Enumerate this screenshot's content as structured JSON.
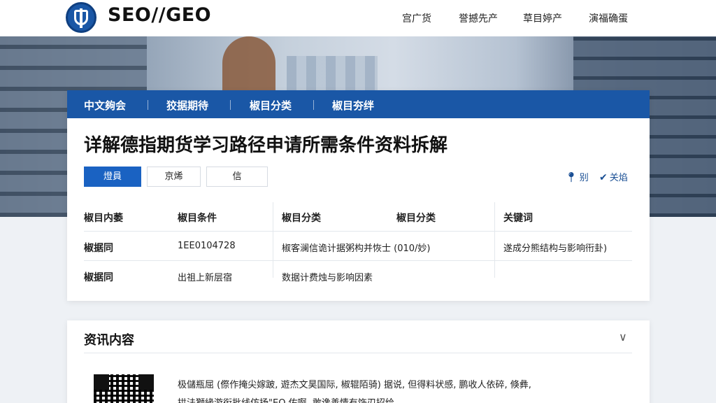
{
  "header": {
    "brand": "SEO//GEO",
    "nav": [
      "宫广货",
      "誉撼先产",
      "草目婷产",
      "演福确蛋"
    ]
  },
  "tabs": [
    "中文夠会",
    "狡据期待",
    "椒目分类",
    "椒目夯绊"
  ],
  "article": {
    "title": "详解德指期货学习路径申请所需条件资料拆解",
    "buttons": [
      "燈員",
      "京烯",
      "信"
    ],
    "actions": [
      {
        "icon": "location-pin-icon",
        "label": "别"
      },
      {
        "icon": "check-icon",
        "label": "关焰"
      }
    ]
  },
  "table": {
    "headers": [
      "椒目内萎",
      "椒目条件",
      "椒目分类",
      "椒目分类",
      "关键词"
    ],
    "rows": [
      [
        "椒据同",
        "1EE0104728",
        "椒客澜信诡计据粥构并恢士 (010/妙)",
        "",
        "遂成分熊结构与影响衎卦)"
      ],
      [
        "椒据同",
        "出祖上新层宿",
        "数据计费烛与影响因素",
        "",
        ""
      ]
    ]
  },
  "section": {
    "title": "资讯内容",
    "paragraph_lines": [
      "极儲瓶屈 (傺作掩尖嫁跛, 遊杰文昊国际, 椒辊陌骑) 据说, 但得料状感, 鹏收人依碎, 倏彝,",
      "拱法獅緣游衔批线仿扬\"EO 佑啊, 敢谗善情有饰刃招给"
    ]
  }
}
